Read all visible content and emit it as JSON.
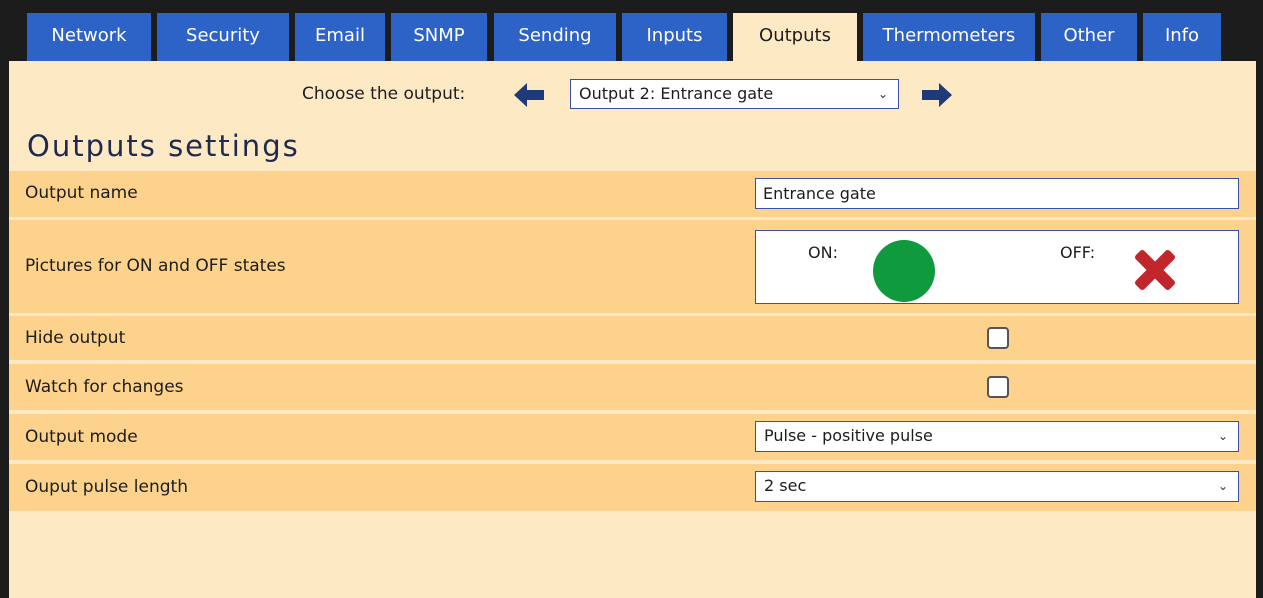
{
  "tabs": [
    {
      "label": "Network",
      "active": false
    },
    {
      "label": "Security",
      "active": false
    },
    {
      "label": "Email",
      "active": false
    },
    {
      "label": "SNMP",
      "active": false
    },
    {
      "label": "Sending",
      "active": false
    },
    {
      "label": "Inputs",
      "active": false
    },
    {
      "label": "Outputs",
      "active": true
    },
    {
      "label": "Thermometers",
      "active": false
    },
    {
      "label": "Other",
      "active": false
    },
    {
      "label": "Info",
      "active": false
    }
  ],
  "chooser": {
    "label": "Choose the output:",
    "selected": "Output 2: Entrance gate"
  },
  "heading": "Outputs settings",
  "settings": {
    "output_name": {
      "label": "Output name",
      "value": "Entrance gate"
    },
    "pictures": {
      "label": "Pictures for ON and OFF states",
      "on_label": "ON:",
      "off_label": "OFF:",
      "on_icon": "green-circle-icon",
      "off_icon": "red-x-icon"
    },
    "hide_output": {
      "label": "Hide output",
      "checked": false
    },
    "watch_changes": {
      "label": "Watch for changes",
      "checked": false
    },
    "output_mode": {
      "label": "Output mode",
      "value": "Pulse - positive pulse"
    },
    "pulse_length": {
      "label": "Ouput pulse length",
      "value": "2 sec"
    }
  },
  "colors": {
    "tab_blue": "#2d62c6",
    "background": "#fde9c4",
    "row_orange": "#fcd28c",
    "on_green": "#0f9a3d",
    "off_red": "#c0262b"
  }
}
